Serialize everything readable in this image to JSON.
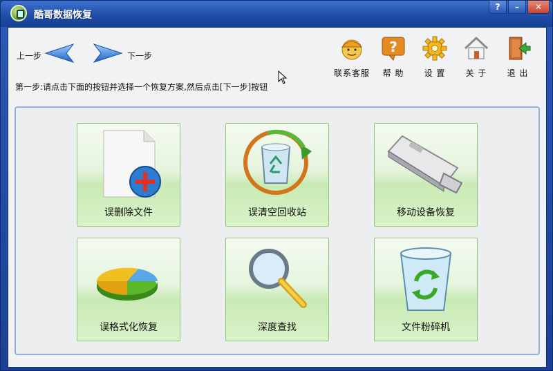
{
  "window": {
    "title": "酷哥数据恢复"
  },
  "window_controls": {
    "help": "?",
    "minimize": "–",
    "close": "✕"
  },
  "nav": {
    "prev_label": "上一步",
    "next_label": "下一步"
  },
  "toolbar": [
    {
      "label": "联系客服",
      "icon": "customer-service-icon"
    },
    {
      "label": "帮 助",
      "icon": "help-icon"
    },
    {
      "label": "设 置",
      "icon": "settings-icon"
    },
    {
      "label": "关 于",
      "icon": "home-icon"
    },
    {
      "label": "退 出",
      "icon": "exit-icon"
    }
  ],
  "instruction": "第一步:请点击下面的按钮并选择一个恢复方案,然后点击[下一步]按钮",
  "options": [
    {
      "label": "误删除文件",
      "icon": "deleted-file-icon"
    },
    {
      "label": "误清空回收站",
      "icon": "recycle-bin-icon"
    },
    {
      "label": "移动设备恢复",
      "icon": "usb-drive-icon"
    },
    {
      "label": "误格式化恢复",
      "icon": "pie-disk-icon"
    },
    {
      "label": "深度查找",
      "icon": "magnifier-icon"
    },
    {
      "label": "文件粉碎机",
      "icon": "shredder-bin-icon"
    }
  ]
}
